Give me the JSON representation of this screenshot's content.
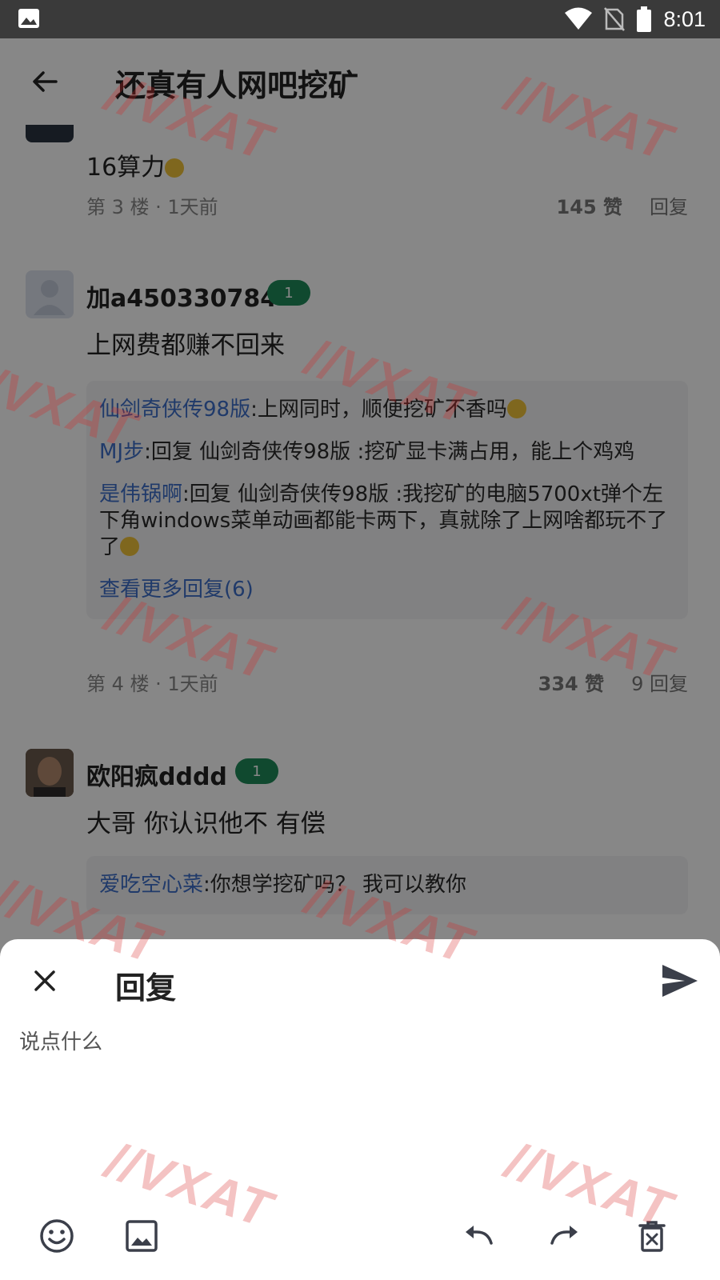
{
  "status_bar": {
    "time": "8:01"
  },
  "app_bar": {
    "title": "还真有人网吧挖矿"
  },
  "partial_comment": {
    "text": "16算力",
    "floor": "第 3 楼 · 1天前",
    "likes": "145 赞",
    "reply": "回复"
  },
  "comments": [
    {
      "username": "加a450330784",
      "level": "1",
      "text": "上网费都赚不回来",
      "replies": [
        {
          "name": "仙剑奇侠传98版",
          "text": ":上网同时，顺便挖矿不香吗"
        },
        {
          "name": "MJ步",
          "text": ":回复 仙剑奇侠传98版 :挖矿显卡满占用，能上个鸡鸡"
        },
        {
          "name": "是伟锅啊",
          "text": ":回复 仙剑奇侠传98版 :我挖矿的电脑5700xt弹个左下角windows菜单动画都能卡两下，真就除了上网啥都玩不了了"
        }
      ],
      "more_replies": "查看更多回复(6)",
      "floor": "第 4 楼 · 1天前",
      "likes": "334 赞",
      "reply_count": "9 回复"
    },
    {
      "username": "欧阳疯dddd",
      "level": "1",
      "text": "大哥 你认识他不 有偿",
      "replies": [
        {
          "name": "爱吃空心菜",
          "text": ":你想学挖矿吗？ 我可以教你"
        }
      ]
    }
  ],
  "reply_sheet": {
    "title": "回复",
    "placeholder": "说点什么"
  },
  "watermark": {
    "text": "//VXAT"
  },
  "icons": {
    "status_left": "image-icon",
    "wifi": "wifi-icon",
    "no_sim": "no-sim-icon",
    "battery": "battery-icon",
    "back": "arrow-back-icon",
    "close": "close-icon",
    "send": "send-icon",
    "emoji": "emoji-icon",
    "image": "image-icon",
    "undo": "undo-icon",
    "redo": "redo-icon",
    "delete": "delete-icon"
  }
}
